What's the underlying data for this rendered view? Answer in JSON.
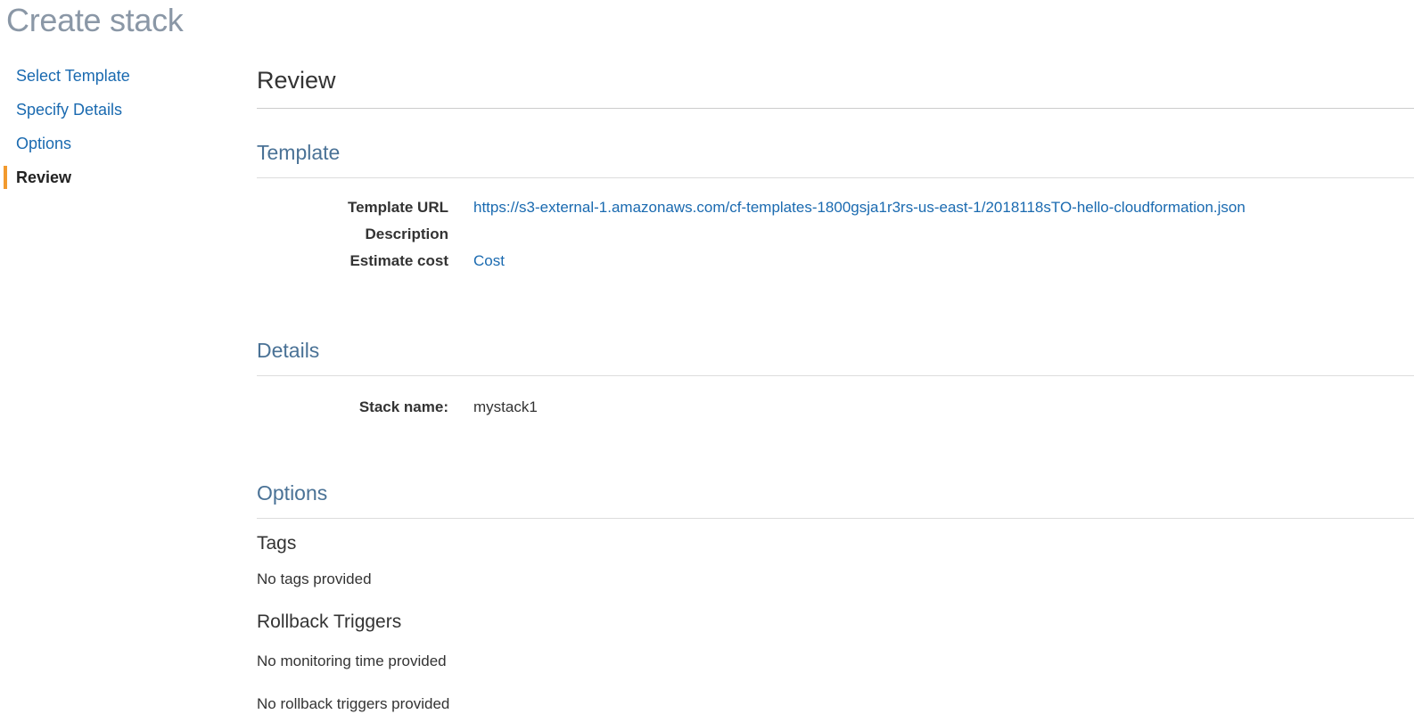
{
  "page": {
    "title": "Create stack"
  },
  "wizard": {
    "steps": [
      {
        "label": "Select Template",
        "active": false
      },
      {
        "label": "Specify Details",
        "active": false
      },
      {
        "label": "Options",
        "active": false
      },
      {
        "label": "Review",
        "active": true
      }
    ]
  },
  "review": {
    "title": "Review",
    "template": {
      "title": "Template",
      "template_url_label": "Template URL",
      "template_url_value": "https://s3-external-1.amazonaws.com/cf-templates-1800gsja1r3rs-us-east-1/2018118sTO-hello-cloudformation.json",
      "description_label": "Description",
      "description_value": "",
      "estimate_cost_label": "Estimate cost",
      "estimate_cost_value": "Cost"
    },
    "details": {
      "title": "Details",
      "stack_name_label": "Stack name:",
      "stack_name_value": "mystack1"
    },
    "options": {
      "title": "Options",
      "tags_heading": "Tags",
      "tags_text": "No tags provided",
      "rollback_heading": "Rollback Triggers",
      "monitoring_text": "No monitoring time provided",
      "rollback_text": "No rollback triggers provided"
    }
  },
  "colors": {
    "accent": "#f29a2e",
    "link": "#1a6ab0",
    "section_title": "#4a7296",
    "page_title": "#8a97a6"
  }
}
